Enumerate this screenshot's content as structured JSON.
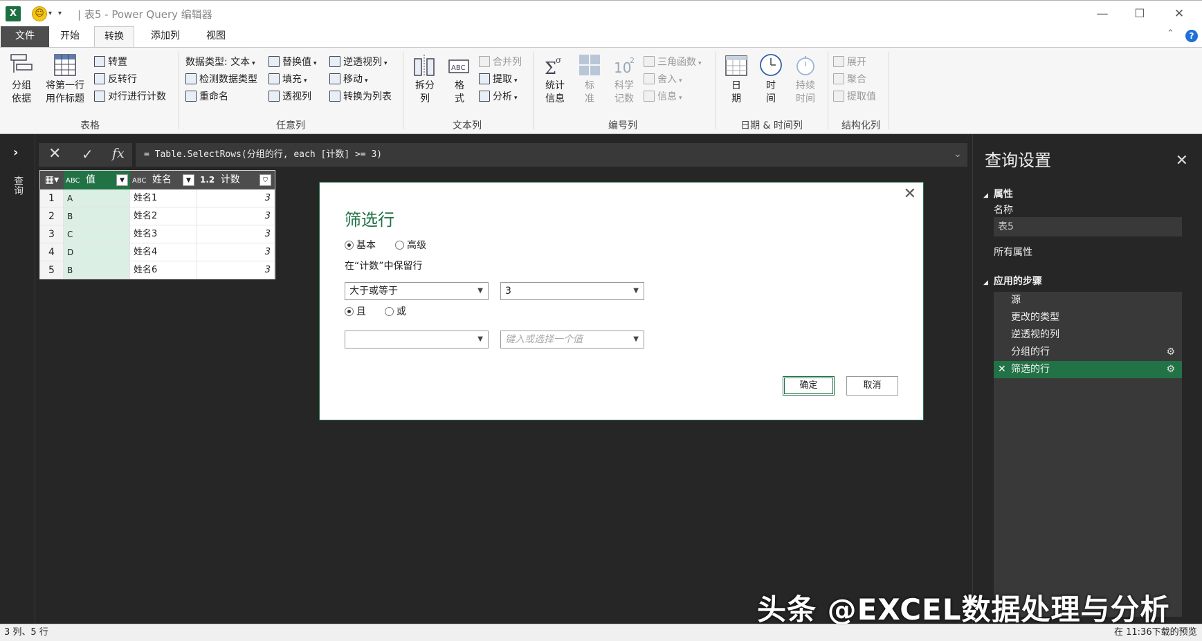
{
  "titlebar": {
    "excel_icon": "X",
    "smiley": "☺",
    "title": "| 表5 - Power Query 编辑器",
    "minimize": "—",
    "maximize": "☐",
    "close": "✕"
  },
  "tabs": [
    "文件",
    "开始",
    "转换",
    "添加列",
    "视图"
  ],
  "ribbon": {
    "table_group": {
      "label": "表格",
      "group_by": "分组\n依据",
      "first_row": "将第一行\n用作标题",
      "transpose": "转置",
      "reverse_rows": "反转行",
      "count_rows": "对行进行计数"
    },
    "anycol_group": {
      "label": "任意列",
      "data_type": "数据类型: 文本",
      "detect_type": "检测数据类型",
      "rename": "重命名",
      "replace_values": "替换值",
      "fill": "填充",
      "pivot": "透视列",
      "unpivot": "逆透视列",
      "move": "移动",
      "to_list": "转换为列表"
    },
    "textcol_group": {
      "label": "文本列",
      "split": "拆分\n列",
      "format": "格\n式",
      "merge": "合并列",
      "extract": "提取",
      "parse": "分析"
    },
    "numcol_group": {
      "label": "编号列",
      "stats": "统计\n信息",
      "standard": "标\n准",
      "scientific": "科学\n记数",
      "trig": "三角函数",
      "round": "舍入",
      "info": "信息"
    },
    "datetime_group": {
      "label": "日期 & 时间列",
      "date": "日\n期",
      "time": "时\n间",
      "duration": "持续\n时间"
    },
    "struct_group": {
      "label": "结构化列",
      "expand": "展开",
      "aggregate": "聚合",
      "extract_values": "提取值"
    }
  },
  "leftnav": {
    "label": "查询"
  },
  "formula": "= Table.SelectRows(分组的行, each [计数] >= 3)",
  "grid": {
    "columns": [
      {
        "type": "ABC",
        "name": "值"
      },
      {
        "type": "ABC",
        "name": "姓名"
      },
      {
        "type": "1.2",
        "name": "计数"
      }
    ],
    "rows": [
      [
        "1",
        "A",
        "姓名1",
        "3"
      ],
      [
        "2",
        "B",
        "姓名2",
        "3"
      ],
      [
        "3",
        "C",
        "姓名3",
        "3"
      ],
      [
        "4",
        "D",
        "姓名4",
        "3"
      ],
      [
        "5",
        "B",
        "姓名6",
        "3"
      ]
    ]
  },
  "dialog": {
    "title": "筛选行",
    "basic": "基本",
    "advanced": "高级",
    "keep_rows": "在“计数”中保留行",
    "op1": "大于或等于",
    "val1": "3",
    "and": "且",
    "or": "或",
    "op2": "",
    "val2_placeholder": "键入或选择一个值",
    "ok": "确定",
    "cancel": "取消"
  },
  "query_settings": {
    "title": "查询设置",
    "props_header": "属性",
    "name_label": "名称",
    "name_value": "表5",
    "all_props": "所有属性",
    "steps_header": "应用的步骤",
    "steps": [
      "源",
      "更改的类型",
      "逆透视的列",
      "分组的行",
      "筛选的行"
    ]
  },
  "status": {
    "left": "3 列、5 行",
    "right": "在 11:36下载的预览"
  },
  "watermark": "头条 @EXCEL数据处理与分析"
}
